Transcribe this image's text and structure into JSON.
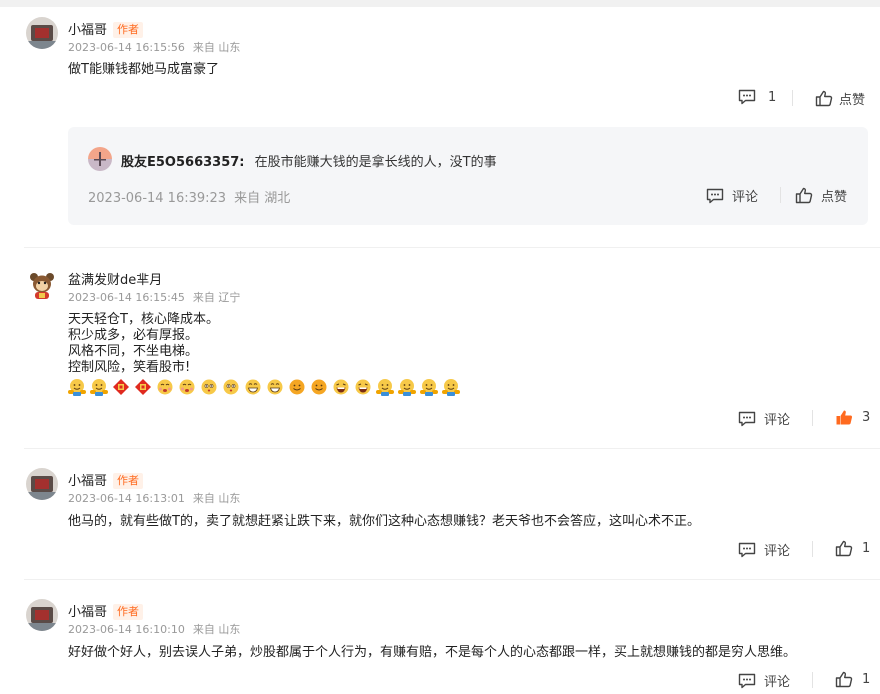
{
  "comments": [
    {
      "user": "小福哥",
      "badge": "作者",
      "time": "2023-06-14 16:15:56",
      "location": "来自 山东",
      "text": "做T能赚钱都她马成富豪了",
      "reply_count": "1",
      "like_label": "点赞",
      "reply": {
        "user": "股友E5O5663357:",
        "text": "在股市能赚大钱的是拿长线的人，没T的事",
        "time": "2023-06-14 16:39:23",
        "location": "来自 湖北",
        "comment_label": "评论",
        "like_label": "点赞"
      }
    },
    {
      "user": "盆满发财de芈月",
      "time": "2023-06-14 16:15:45",
      "location": "来自 辽宁",
      "lines": [
        "天天轻仓T，核心降成本。",
        "积少成多，必有厚报。",
        "风格不同，不坐电梯。",
        "控制风险，笑看股市!"
      ],
      "emojis": [
        "hug",
        "hug",
        "fortune",
        "fortune",
        "blush",
        "blush",
        "shy",
        "shy",
        "grin",
        "grin",
        "smile",
        "smile",
        "laugh",
        "laugh",
        "hug",
        "hug",
        "hug",
        "hug"
      ],
      "comment_label": "评论",
      "like_count": "3",
      "liked": true
    },
    {
      "user": "小福哥",
      "badge": "作者",
      "time": "2023-06-14 16:13:01",
      "location": "来自 山东",
      "text": "他马的，就有些做T的，卖了就想赶紧让跌下来，就你们这种心态想赚钱？老天爷也不会答应，这叫心术不正。",
      "comment_label": "评论",
      "like_count": "1"
    },
    {
      "user": "小福哥",
      "badge": "作者",
      "time": "2023-06-14 16:10:10",
      "location": "来自 山东",
      "text": "好好做个好人，别去误人子弟，炒股都属于个人行为，有赚有赔，不是每个人的心态都跟一样，买上就想赚钱的都是穷人思维。",
      "comment_label": "评论",
      "like_count": "1"
    }
  ],
  "colors": {
    "accent": "#ff6a1f",
    "muted": "#999999",
    "reply_bg": "#f5f6f8"
  }
}
